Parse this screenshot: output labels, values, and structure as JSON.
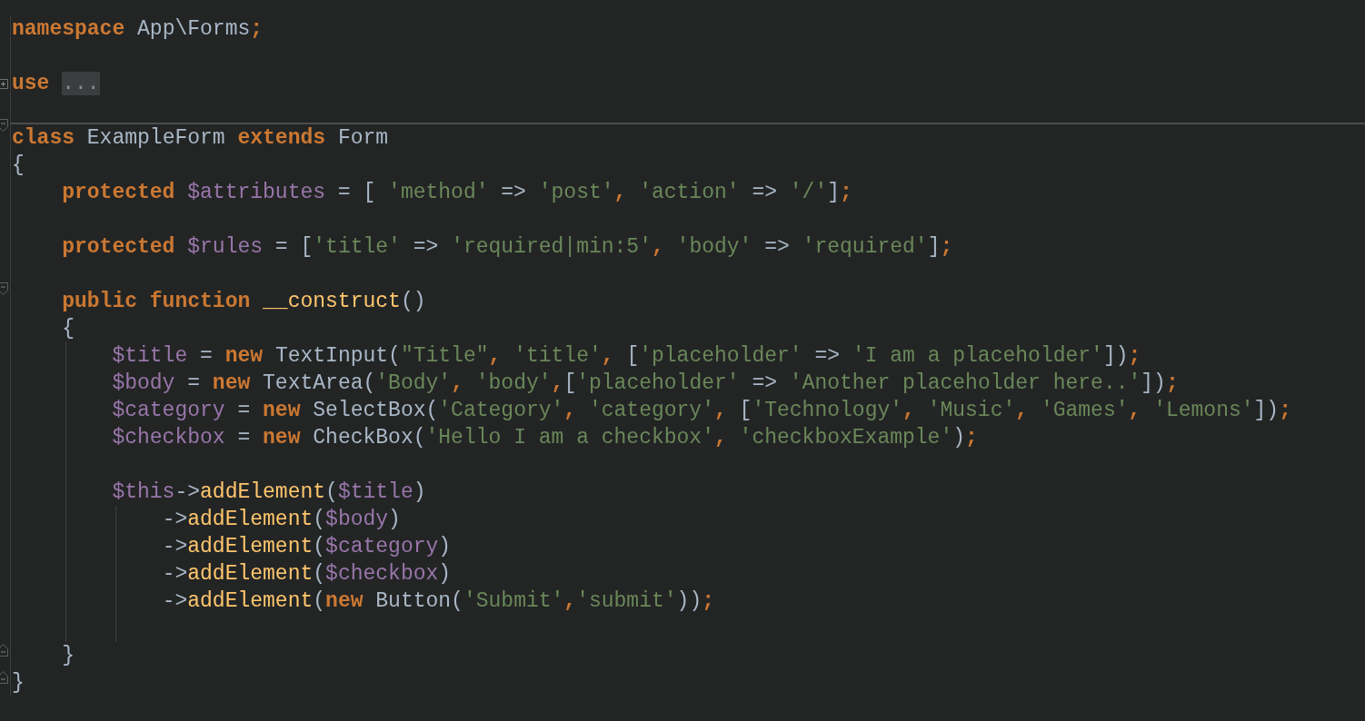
{
  "editor": {
    "lines": [
      {
        "kind": "code",
        "tokens": [
          {
            "kind": "keyword",
            "text": "namespace"
          },
          {
            "kind": "plain",
            "text": " App\\Forms"
          },
          {
            "kind": "keyword",
            "text": ";"
          }
        ]
      },
      {
        "kind": "blank"
      },
      {
        "kind": "collapsed",
        "tokens": [
          {
            "kind": "keyword",
            "text": "use "
          },
          {
            "kind": "folded",
            "text": "..."
          }
        ]
      },
      {
        "kind": "blank",
        "divider": true
      },
      {
        "kind": "fold-start",
        "tokens": [
          {
            "kind": "keyword",
            "text": "class"
          },
          {
            "kind": "plain",
            "text": " ExampleForm "
          },
          {
            "kind": "keyword",
            "text": "extends"
          },
          {
            "kind": "plain",
            "text": " Form"
          }
        ]
      },
      {
        "kind": "code",
        "tokens": [
          {
            "kind": "plain",
            "text": "{"
          }
        ],
        "children": [
          {
            "kind": "code",
            "tokens": [
              {
                "kind": "keyword",
                "text": "protected "
              },
              {
                "kind": "variable",
                "text": "$attributes"
              },
              {
                "kind": "plain",
                "text": " = [ "
              },
              {
                "kind": "string",
                "text": "'method'"
              },
              {
                "kind": "plain",
                "text": " => "
              },
              {
                "kind": "string",
                "text": "'post'"
              },
              {
                "kind": "keyword",
                "text": ", "
              },
              {
                "kind": "string",
                "text": "'action'"
              },
              {
                "kind": "plain",
                "text": " => "
              },
              {
                "kind": "string",
                "text": "'/'"
              },
              {
                "kind": "plain",
                "text": "]"
              },
              {
                "kind": "keyword",
                "text": ";"
              }
            ]
          },
          {
            "kind": "blank"
          },
          {
            "kind": "code",
            "tokens": [
              {
                "kind": "keyword",
                "text": "protected "
              },
              {
                "kind": "variable",
                "text": "$rules"
              },
              {
                "kind": "plain",
                "text": " = ["
              },
              {
                "kind": "string",
                "text": "'title'"
              },
              {
                "kind": "plain",
                "text": " => "
              },
              {
                "kind": "string",
                "text": "'required|min:5'"
              },
              {
                "kind": "keyword",
                "text": ", "
              },
              {
                "kind": "string",
                "text": "'body'"
              },
              {
                "kind": "plain",
                "text": " => "
              },
              {
                "kind": "string",
                "text": "'required'"
              },
              {
                "kind": "plain",
                "text": "]"
              },
              {
                "kind": "keyword",
                "text": ";"
              }
            ]
          },
          {
            "kind": "blank"
          },
          {
            "kind": "fold-start",
            "tokens": [
              {
                "kind": "keyword",
                "text": "public function "
              },
              {
                "kind": "method",
                "text": "__construct"
              },
              {
                "kind": "plain",
                "text": "()"
              }
            ]
          },
          {
            "kind": "code",
            "tokens": [
              {
                "kind": "plain",
                "text": "{"
              }
            ],
            "children": [
              {
                "kind": "code",
                "tokens": [
                  {
                    "kind": "variable",
                    "text": "$title"
                  },
                  {
                    "kind": "plain",
                    "text": " = "
                  },
                  {
                    "kind": "keyword",
                    "text": "new"
                  },
                  {
                    "kind": "plain",
                    "text": " TextInput("
                  },
                  {
                    "kind": "string",
                    "text": "\"Title\""
                  },
                  {
                    "kind": "keyword",
                    "text": ", "
                  },
                  {
                    "kind": "string",
                    "text": "'title'"
                  },
                  {
                    "kind": "keyword",
                    "text": ","
                  },
                  {
                    "kind": "plain",
                    "text": " ["
                  },
                  {
                    "kind": "string",
                    "text": "'placeholder'"
                  },
                  {
                    "kind": "plain",
                    "text": " => "
                  },
                  {
                    "kind": "string",
                    "text": "'I am a placeholder'"
                  },
                  {
                    "kind": "plain",
                    "text": "])"
                  },
                  {
                    "kind": "keyword",
                    "text": ";"
                  }
                ]
              },
              {
                "kind": "code",
                "tokens": [
                  {
                    "kind": "variable",
                    "text": "$body"
                  },
                  {
                    "kind": "plain",
                    "text": " = "
                  },
                  {
                    "kind": "keyword",
                    "text": "new"
                  },
                  {
                    "kind": "plain",
                    "text": " TextArea("
                  },
                  {
                    "kind": "string",
                    "text": "'Body'"
                  },
                  {
                    "kind": "keyword",
                    "text": ", "
                  },
                  {
                    "kind": "string",
                    "text": "'body'"
                  },
                  {
                    "kind": "keyword",
                    "text": ","
                  },
                  {
                    "kind": "plain",
                    "text": "["
                  },
                  {
                    "kind": "string",
                    "text": "'placeholder'"
                  },
                  {
                    "kind": "plain",
                    "text": " => "
                  },
                  {
                    "kind": "string",
                    "text": "'Another placeholder here..'"
                  },
                  {
                    "kind": "plain",
                    "text": "])"
                  },
                  {
                    "kind": "keyword",
                    "text": ";"
                  }
                ]
              },
              {
                "kind": "code",
                "tokens": [
                  {
                    "kind": "variable",
                    "text": "$category"
                  },
                  {
                    "kind": "plain",
                    "text": " = "
                  },
                  {
                    "kind": "keyword",
                    "text": "new"
                  },
                  {
                    "kind": "plain",
                    "text": " SelectBox("
                  },
                  {
                    "kind": "string",
                    "text": "'Category'"
                  },
                  {
                    "kind": "keyword",
                    "text": ", "
                  },
                  {
                    "kind": "string",
                    "text": "'category'"
                  },
                  {
                    "kind": "keyword",
                    "text": ","
                  },
                  {
                    "kind": "plain",
                    "text": " ["
                  },
                  {
                    "kind": "string",
                    "text": "'Technology'"
                  },
                  {
                    "kind": "keyword",
                    "text": ", "
                  },
                  {
                    "kind": "string",
                    "text": "'Music'"
                  },
                  {
                    "kind": "keyword",
                    "text": ", "
                  },
                  {
                    "kind": "string",
                    "text": "'Games'"
                  },
                  {
                    "kind": "keyword",
                    "text": ", "
                  },
                  {
                    "kind": "string",
                    "text": "'Lemons'"
                  },
                  {
                    "kind": "plain",
                    "text": "])"
                  },
                  {
                    "kind": "keyword",
                    "text": ";"
                  }
                ]
              },
              {
                "kind": "code",
                "tokens": [
                  {
                    "kind": "variable",
                    "text": "$checkbox"
                  },
                  {
                    "kind": "plain",
                    "text": " = "
                  },
                  {
                    "kind": "keyword",
                    "text": "new"
                  },
                  {
                    "kind": "plain",
                    "text": " CheckBox("
                  },
                  {
                    "kind": "string",
                    "text": "'Hello I am a checkbox'"
                  },
                  {
                    "kind": "keyword",
                    "text": ", "
                  },
                  {
                    "kind": "string",
                    "text": "'checkboxExample'"
                  },
                  {
                    "kind": "plain",
                    "text": ")"
                  },
                  {
                    "kind": "keyword",
                    "text": ";"
                  }
                ]
              },
              {
                "kind": "blank"
              },
              {
                "kind": "code",
                "tokens": [
                  {
                    "kind": "variable",
                    "text": "$this"
                  },
                  {
                    "kind": "plain",
                    "text": "->"
                  },
                  {
                    "kind": "method",
                    "text": "addElement"
                  },
                  {
                    "kind": "plain",
                    "text": "("
                  },
                  {
                    "kind": "variable",
                    "text": "$title"
                  },
                  {
                    "kind": "plain",
                    "text": ")"
                  }
                ],
                "children": [
                  {
                    "kind": "code",
                    "tokens": [
                      {
                        "kind": "plain",
                        "text": "->"
                      },
                      {
                        "kind": "method",
                        "text": "addElement"
                      },
                      {
                        "kind": "plain",
                        "text": "("
                      },
                      {
                        "kind": "variable",
                        "text": "$body"
                      },
                      {
                        "kind": "plain",
                        "text": ")"
                      }
                    ]
                  },
                  {
                    "kind": "code",
                    "tokens": [
                      {
                        "kind": "plain",
                        "text": "->"
                      },
                      {
                        "kind": "method",
                        "text": "addElement"
                      },
                      {
                        "kind": "plain",
                        "text": "("
                      },
                      {
                        "kind": "variable",
                        "text": "$category"
                      },
                      {
                        "kind": "plain",
                        "text": ")"
                      }
                    ]
                  },
                  {
                    "kind": "code",
                    "tokens": [
                      {
                        "kind": "plain",
                        "text": "->"
                      },
                      {
                        "kind": "method",
                        "text": "addElement"
                      },
                      {
                        "kind": "plain",
                        "text": "("
                      },
                      {
                        "kind": "variable",
                        "text": "$checkbox"
                      },
                      {
                        "kind": "plain",
                        "text": ")"
                      }
                    ]
                  },
                  {
                    "kind": "code",
                    "tokens": [
                      {
                        "kind": "plain",
                        "text": "->"
                      },
                      {
                        "kind": "method",
                        "text": "addElement"
                      },
                      {
                        "kind": "plain",
                        "text": "("
                      },
                      {
                        "kind": "keyword",
                        "text": "new"
                      },
                      {
                        "kind": "plain",
                        "text": " Button("
                      },
                      {
                        "kind": "string",
                        "text": "'Submit'"
                      },
                      {
                        "kind": "keyword",
                        "text": ","
                      },
                      {
                        "kind": "string",
                        "text": "'submit'"
                      },
                      {
                        "kind": "plain",
                        "text": "))"
                      },
                      {
                        "kind": "keyword",
                        "text": ";"
                      }
                    ]
                  },
                  {
                    "kind": "blank"
                  }
                ]
              }
            ]
          },
          {
            "kind": "fold-end",
            "tokens": [
              {
                "kind": "plain",
                "text": "}"
              }
            ]
          }
        ]
      },
      {
        "kind": "fold-end",
        "tokens": [
          {
            "kind": "plain",
            "text": "}"
          }
        ]
      }
    ]
  }
}
